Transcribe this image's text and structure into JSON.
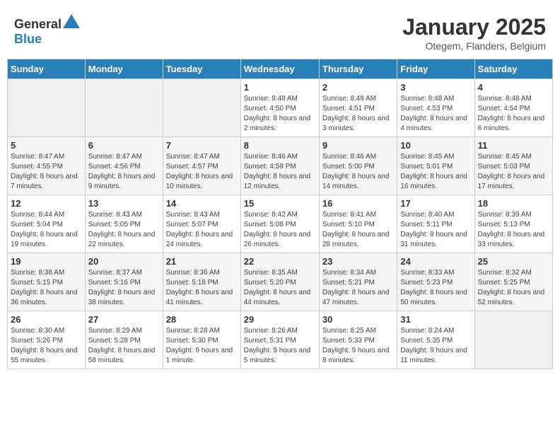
{
  "header": {
    "logo_general": "General",
    "logo_blue": "Blue",
    "month_title": "January 2025",
    "subtitle": "Otegem, Flanders, Belgium"
  },
  "weekdays": [
    "Sunday",
    "Monday",
    "Tuesday",
    "Wednesday",
    "Thursday",
    "Friday",
    "Saturday"
  ],
  "weeks": [
    [
      {
        "day": "",
        "sunrise": "",
        "sunset": "",
        "daylight": ""
      },
      {
        "day": "",
        "sunrise": "",
        "sunset": "",
        "daylight": ""
      },
      {
        "day": "",
        "sunrise": "",
        "sunset": "",
        "daylight": ""
      },
      {
        "day": "1",
        "sunrise": "Sunrise: 8:48 AM",
        "sunset": "Sunset: 4:50 PM",
        "daylight": "Daylight: 8 hours and 2 minutes."
      },
      {
        "day": "2",
        "sunrise": "Sunrise: 8:48 AM",
        "sunset": "Sunset: 4:51 PM",
        "daylight": "Daylight: 8 hours and 3 minutes."
      },
      {
        "day": "3",
        "sunrise": "Sunrise: 8:48 AM",
        "sunset": "Sunset: 4:53 PM",
        "daylight": "Daylight: 8 hours and 4 minutes."
      },
      {
        "day": "4",
        "sunrise": "Sunrise: 8:48 AM",
        "sunset": "Sunset: 4:54 PM",
        "daylight": "Daylight: 8 hours and 6 minutes."
      }
    ],
    [
      {
        "day": "5",
        "sunrise": "Sunrise: 8:47 AM",
        "sunset": "Sunset: 4:55 PM",
        "daylight": "Daylight: 8 hours and 7 minutes."
      },
      {
        "day": "6",
        "sunrise": "Sunrise: 8:47 AM",
        "sunset": "Sunset: 4:56 PM",
        "daylight": "Daylight: 8 hours and 9 minutes."
      },
      {
        "day": "7",
        "sunrise": "Sunrise: 8:47 AM",
        "sunset": "Sunset: 4:57 PM",
        "daylight": "Daylight: 8 hours and 10 minutes."
      },
      {
        "day": "8",
        "sunrise": "Sunrise: 8:46 AM",
        "sunset": "Sunset: 4:59 PM",
        "daylight": "Daylight: 8 hours and 12 minutes."
      },
      {
        "day": "9",
        "sunrise": "Sunrise: 8:46 AM",
        "sunset": "Sunset: 5:00 PM",
        "daylight": "Daylight: 8 hours and 14 minutes."
      },
      {
        "day": "10",
        "sunrise": "Sunrise: 8:45 AM",
        "sunset": "Sunset: 5:01 PM",
        "daylight": "Daylight: 8 hours and 16 minutes."
      },
      {
        "day": "11",
        "sunrise": "Sunrise: 8:45 AM",
        "sunset": "Sunset: 5:03 PM",
        "daylight": "Daylight: 8 hours and 17 minutes."
      }
    ],
    [
      {
        "day": "12",
        "sunrise": "Sunrise: 8:44 AM",
        "sunset": "Sunset: 5:04 PM",
        "daylight": "Daylight: 8 hours and 19 minutes."
      },
      {
        "day": "13",
        "sunrise": "Sunrise: 8:43 AM",
        "sunset": "Sunset: 5:05 PM",
        "daylight": "Daylight: 8 hours and 22 minutes."
      },
      {
        "day": "14",
        "sunrise": "Sunrise: 8:43 AM",
        "sunset": "Sunset: 5:07 PM",
        "daylight": "Daylight: 8 hours and 24 minutes."
      },
      {
        "day": "15",
        "sunrise": "Sunrise: 8:42 AM",
        "sunset": "Sunset: 5:08 PM",
        "daylight": "Daylight: 8 hours and 26 minutes."
      },
      {
        "day": "16",
        "sunrise": "Sunrise: 8:41 AM",
        "sunset": "Sunset: 5:10 PM",
        "daylight": "Daylight: 8 hours and 28 minutes."
      },
      {
        "day": "17",
        "sunrise": "Sunrise: 8:40 AM",
        "sunset": "Sunset: 5:11 PM",
        "daylight": "Daylight: 8 hours and 31 minutes."
      },
      {
        "day": "18",
        "sunrise": "Sunrise: 8:39 AM",
        "sunset": "Sunset: 5:13 PM",
        "daylight": "Daylight: 8 hours and 33 minutes."
      }
    ],
    [
      {
        "day": "19",
        "sunrise": "Sunrise: 8:38 AM",
        "sunset": "Sunset: 5:15 PM",
        "daylight": "Daylight: 8 hours and 36 minutes."
      },
      {
        "day": "20",
        "sunrise": "Sunrise: 8:37 AM",
        "sunset": "Sunset: 5:16 PM",
        "daylight": "Daylight: 8 hours and 38 minutes."
      },
      {
        "day": "21",
        "sunrise": "Sunrise: 8:36 AM",
        "sunset": "Sunset: 5:18 PM",
        "daylight": "Daylight: 8 hours and 41 minutes."
      },
      {
        "day": "22",
        "sunrise": "Sunrise: 8:35 AM",
        "sunset": "Sunset: 5:20 PM",
        "daylight": "Daylight: 8 hours and 44 minutes."
      },
      {
        "day": "23",
        "sunrise": "Sunrise: 8:34 AM",
        "sunset": "Sunset: 5:21 PM",
        "daylight": "Daylight: 8 hours and 47 minutes."
      },
      {
        "day": "24",
        "sunrise": "Sunrise: 8:33 AM",
        "sunset": "Sunset: 5:23 PM",
        "daylight": "Daylight: 8 hours and 50 minutes."
      },
      {
        "day": "25",
        "sunrise": "Sunrise: 8:32 AM",
        "sunset": "Sunset: 5:25 PM",
        "daylight": "Daylight: 8 hours and 52 minutes."
      }
    ],
    [
      {
        "day": "26",
        "sunrise": "Sunrise: 8:30 AM",
        "sunset": "Sunset: 5:26 PM",
        "daylight": "Daylight: 8 hours and 55 minutes."
      },
      {
        "day": "27",
        "sunrise": "Sunrise: 8:29 AM",
        "sunset": "Sunset: 5:28 PM",
        "daylight": "Daylight: 8 hours and 58 minutes."
      },
      {
        "day": "28",
        "sunrise": "Sunrise: 8:28 AM",
        "sunset": "Sunset: 5:30 PM",
        "daylight": "Daylight: 9 hours and 1 minute."
      },
      {
        "day": "29",
        "sunrise": "Sunrise: 8:26 AM",
        "sunset": "Sunset: 5:31 PM",
        "daylight": "Daylight: 9 hours and 5 minutes."
      },
      {
        "day": "30",
        "sunrise": "Sunrise: 8:25 AM",
        "sunset": "Sunset: 5:33 PM",
        "daylight": "Daylight: 9 hours and 8 minutes."
      },
      {
        "day": "31",
        "sunrise": "Sunrise: 8:24 AM",
        "sunset": "Sunset: 5:35 PM",
        "daylight": "Daylight: 9 hours and 11 minutes."
      },
      {
        "day": "",
        "sunrise": "",
        "sunset": "",
        "daylight": ""
      }
    ]
  ]
}
